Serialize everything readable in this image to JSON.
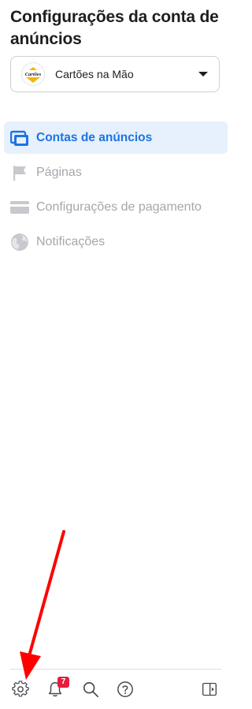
{
  "header": {
    "title": "Configurações da conta de anúncios"
  },
  "account_selector": {
    "name": "Cartões na Mão",
    "logo_text": "Cartões"
  },
  "nav": {
    "items": [
      {
        "label": "Contas de anúncios",
        "icon": "ad-accounts-icon",
        "active": true
      },
      {
        "label": "Páginas",
        "icon": "flag-icon",
        "active": false
      },
      {
        "label": "Configurações de pagamento",
        "icon": "credit-card-icon",
        "active": false
      },
      {
        "label": "Notificações",
        "icon": "globe-icon",
        "active": false
      }
    ]
  },
  "footer": {
    "notification_count": "7",
    "icons": [
      "gear-icon",
      "bell-icon",
      "search-icon",
      "help-icon",
      "panel-toggle-icon"
    ]
  },
  "colors": {
    "accent": "#1b74e4",
    "active_bg": "#e7f0fd",
    "badge": "#e41e3f",
    "annotation_arrow": "#ff0000"
  }
}
